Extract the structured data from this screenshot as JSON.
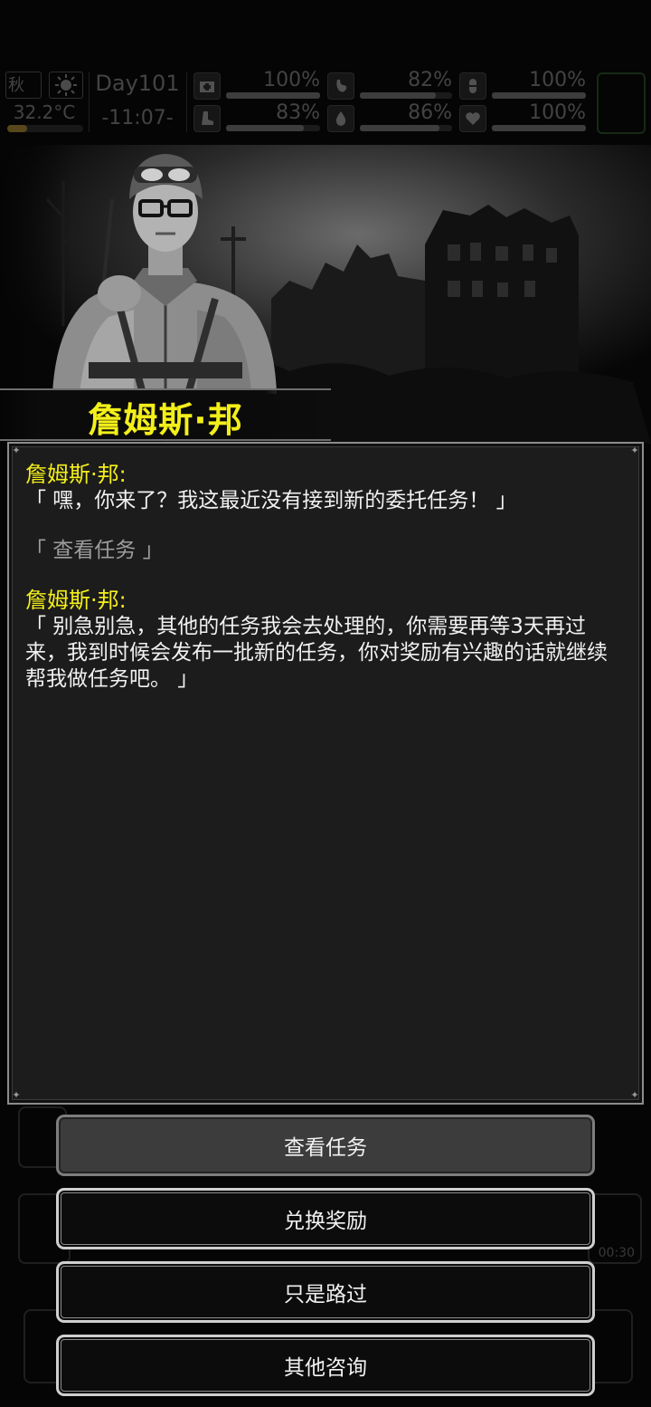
{
  "hud": {
    "season": "秋",
    "weather_icon": "sun-icon",
    "temperature": "32.2°C",
    "temperature_level": 0.26,
    "day": "Day101",
    "time": "-11:07-",
    "stats": [
      {
        "icon": "medkit-icon",
        "value": "100%",
        "level": 1.0
      },
      {
        "icon": "stomach-icon",
        "value": "82%",
        "level": 0.82
      },
      {
        "icon": "pill-icon",
        "value": "100%",
        "level": 1.0
      },
      {
        "icon": "boot-icon",
        "value": "83%",
        "level": 0.83
      },
      {
        "icon": "water-drop-icon",
        "value": "86%",
        "level": 0.86
      },
      {
        "icon": "heart-icon",
        "value": "100%",
        "level": 1.0
      }
    ]
  },
  "npc": {
    "name": "詹姆斯·邦"
  },
  "dialog": {
    "entries": [
      {
        "speaker": "詹姆斯·邦:",
        "text": "「 嘿，你来了？我这最近没有接到新的委托任务！ 」"
      },
      {
        "choice": "「 查看任务 」"
      },
      {
        "speaker": "詹姆斯·邦:",
        "text": "「 别急别急，其他的任务我会去处理的，你需要再等3天再过来，我到时候会发布一批新的任务，你对奖励有兴趣的话就继续帮我做任务吧。 」"
      }
    ]
  },
  "buttons": {
    "view_tasks": "查看任务",
    "exchange_rewards": "兑换奖励",
    "just_passing": "只是路过",
    "other_inquiry": "其他咨询"
  },
  "background": {
    "timer": "00:30"
  },
  "colors": {
    "npc_name": "#f3ef1a",
    "text": "#f1f1f1",
    "choice_text": "#9d9d9d",
    "panel": "#1c1c1c"
  }
}
